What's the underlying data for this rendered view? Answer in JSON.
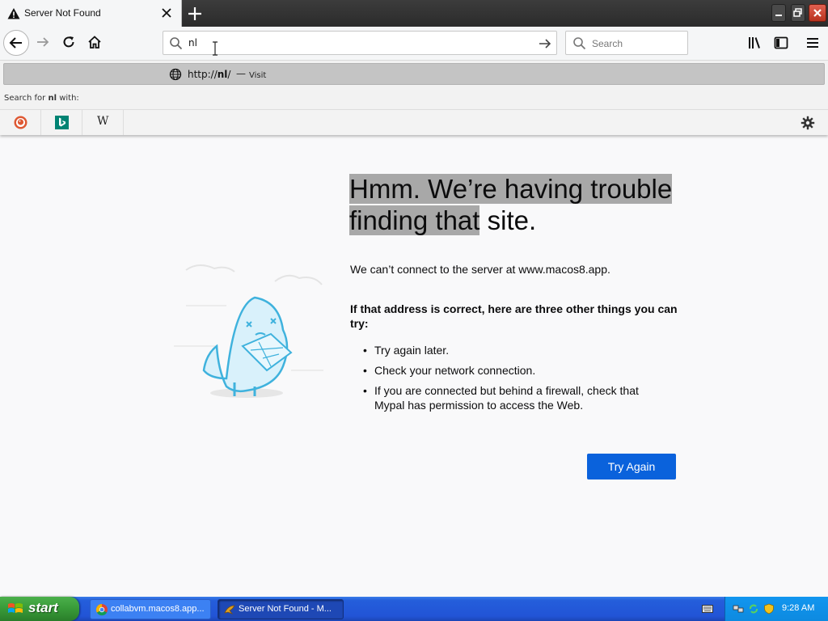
{
  "browser": {
    "tab": {
      "title": "Server Not Found"
    },
    "url_input": {
      "value": "nl"
    },
    "search": {
      "placeholder": "Search"
    }
  },
  "url_popup": {
    "suggestion": {
      "url_prefix": "http://",
      "url_bold": "nl",
      "url_suffix": "/",
      "separator": "—",
      "action": "Visit"
    },
    "search_for": {
      "prefix": "Search for ",
      "term": "nl",
      "suffix": " with:"
    },
    "engines": [
      {
        "name": "duckduckgo-icon"
      },
      {
        "name": "bing-icon"
      },
      {
        "name": "wikipedia-icon",
        "glyph": "W"
      }
    ]
  },
  "error_page": {
    "title_selected": "Hmm. We’re having trouble finding that",
    "title_rest": " site.",
    "message": "We can’t connect to the server at www.macos8.app.",
    "hint": "If that address is correct, here are three other things you can try:",
    "suggestions": [
      "Try again later.",
      "Check your network connection.",
      "If you are connected but behind a firewall, check that Mypal has permission to access the Web."
    ],
    "button": "Try Again",
    "accent_color": "#0a62dc"
  },
  "taskbar": {
    "start": "start",
    "tasks": [
      {
        "label": "collabvm.macos8.app...",
        "active": false
      },
      {
        "label": "Server Not Found - M...",
        "active": true
      }
    ],
    "clock": "9:28 AM"
  }
}
